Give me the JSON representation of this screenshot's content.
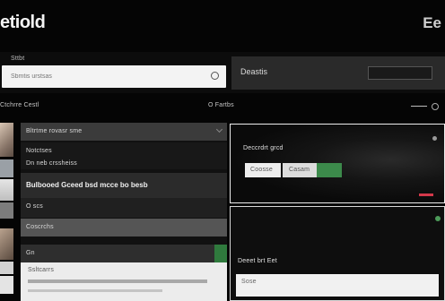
{
  "header": {
    "title": "etiold",
    "right_text": "Ee"
  },
  "search": {
    "label": "Sttbt",
    "placeholder": "Sbmtis urstsas",
    "value": ""
  },
  "right_bar": {
    "label": "Deastis"
  },
  "section": {
    "left_label": "Ctchrre Cestl",
    "right_label": "O Fartbs"
  },
  "list": {
    "rows": [
      "Bltrtme rovasr sme",
      "Notctses",
      "Dn neb crssheiss",
      "Bulbooed Gceed bsd mcce bo besb",
      "O scs",
      "Coscrchs",
      "Gn",
      "Ssltcarrs"
    ]
  },
  "card_1": {
    "title": "Deccrdrt grcd",
    "input_text": "Coosse",
    "select_text": "Casam"
  },
  "card_2": {
    "title": "Deeet brt Eet",
    "field_text": "Sose"
  },
  "colors": {
    "accent_green": "#3c8a4b",
    "accent_red": "#d3384a",
    "background": "#050505"
  }
}
